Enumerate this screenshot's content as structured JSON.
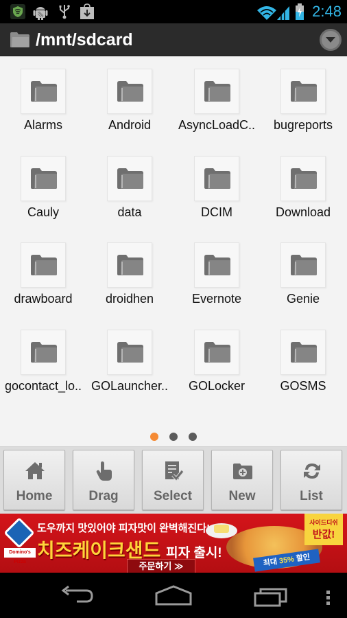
{
  "status_bar": {
    "icons": [
      "shield-icon",
      "android-debug-icon",
      "usb-icon",
      "download-icon",
      "wifi-icon",
      "signal-icon",
      "battery-charging-icon"
    ],
    "time": "2:48"
  },
  "title_bar": {
    "path": "/mnt/sdcard",
    "menu_icon": "overflow-dropdown-icon"
  },
  "folders": [
    {
      "name": "Alarms"
    },
    {
      "name": "Android"
    },
    {
      "name": "AsyncLoadC.."
    },
    {
      "name": "bugreports"
    },
    {
      "name": "Cauly"
    },
    {
      "name": "data"
    },
    {
      "name": "DCIM"
    },
    {
      "name": "Download"
    },
    {
      "name": "drawboard"
    },
    {
      "name": "droidhen"
    },
    {
      "name": "Evernote"
    },
    {
      "name": "Genie"
    },
    {
      "name": "gocontact_lo.."
    },
    {
      "name": "GOLauncher.."
    },
    {
      "name": "GOLocker"
    },
    {
      "name": "GOSMS"
    }
  ],
  "pager": {
    "pages": 3,
    "current": 1
  },
  "toolbar": {
    "buttons": [
      {
        "label": "Home",
        "icon": "home-icon"
      },
      {
        "label": "Drag",
        "icon": "hand-pointer-icon"
      },
      {
        "label": "Select",
        "icon": "checklist-icon"
      },
      {
        "label": "New",
        "icon": "new-folder-icon"
      },
      {
        "label": "List",
        "icon": "refresh-icon"
      }
    ]
  },
  "ad": {
    "brand": "Domino's Pizza",
    "headline": "도우까지 맛있어야 피자맛이 완벽해진다!",
    "product": "치즈케이크샌드",
    "product_suffix": "피자 출시!",
    "order_button": "주문하기 ≫",
    "ribbon_prefix": "최대",
    "ribbon_percent": "35%",
    "ribbon_suffix": "할인",
    "badge_small": "사이드디쉬",
    "badge_big": "반값!"
  },
  "nav_bar": {
    "buttons": [
      "back-icon",
      "home-icon",
      "recent-apps-icon",
      "menu-icon"
    ]
  },
  "colors": {
    "accent_time": "#33b5e5",
    "pager_active": "#f58a33",
    "pager_inactive": "#5b5b5b",
    "ad_red": "#d4141a"
  }
}
